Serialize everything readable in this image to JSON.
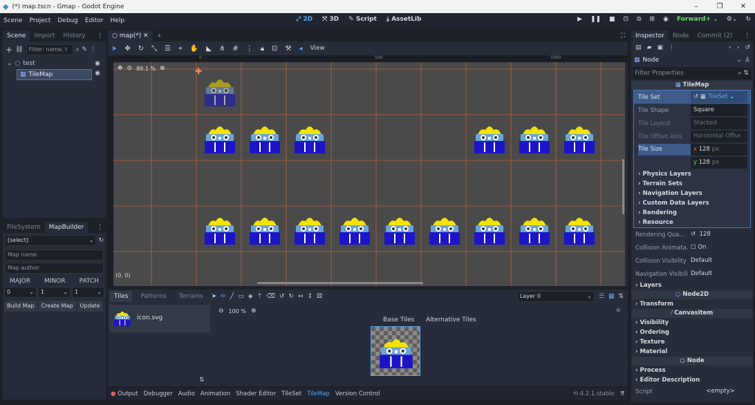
{
  "window": {
    "title": "(*) map.tscn - Gmap - Godot Engine",
    "controls": [
      "–",
      "❐",
      "✕"
    ]
  },
  "menu": [
    "Scene",
    "Project",
    "Debug",
    "Editor",
    "Help"
  ],
  "workspaces": [
    {
      "label": "2D",
      "active": true
    },
    {
      "label": "3D"
    },
    {
      "label": "Script"
    },
    {
      "label": "AssetLib"
    }
  ],
  "renderer": "Forward+",
  "scene_dock": {
    "tabs": [
      "Scene",
      "Import",
      "History"
    ],
    "filter_placeholder": "Filter: name, t",
    "tree": [
      {
        "label": "test",
        "level": 0
      },
      {
        "label": "TileMap",
        "level": 1,
        "selected": true
      }
    ]
  },
  "fs_dock": {
    "tabs": [
      "FileSystem",
      "MapBuilder"
    ],
    "select": "[select]",
    "map_name": "Map name",
    "map_author": "Map author",
    "version_headers": [
      "MAJOR",
      "MINOR",
      "PATCH"
    ],
    "version_values": [
      "0",
      "1",
      "1"
    ],
    "buttons": [
      "Build Map",
      "Create Map",
      "Update"
    ]
  },
  "viewport": {
    "tab": "map(*)",
    "zoom": "89.1 %",
    "view_label": "View",
    "origin_label": "(0, 0)",
    "ruler": [
      "0",
      "500",
      "1000"
    ]
  },
  "tilemap_panel": {
    "tabs": [
      "Tiles",
      "Patterns",
      "Terrains"
    ],
    "source": "icon.svg",
    "zoom": "100 %",
    "atlas_tabs": [
      "Base Tiles",
      "Alternative Tiles"
    ],
    "layer": "Layer 0"
  },
  "bottom_tabs": [
    "Output",
    "Debugger",
    "Audio",
    "Animation",
    "Shader Editor",
    "TileSet",
    "TileMap",
    "Version Control"
  ],
  "version": "4.2.1.stable",
  "inspector": {
    "tabs": [
      "Inspector",
      "Node",
      "Commit (2)"
    ],
    "node": "Node",
    "filter_placeholder": "Filter Properties",
    "class": "TileMap",
    "tile_set": {
      "label": "Tile Set",
      "value": "TileSet"
    },
    "props": [
      {
        "k": "Tile Shape",
        "v": "Square"
      },
      {
        "k": "Tile Layout",
        "v": "Stacked"
      },
      {
        "k": "Tile Offset Axis",
        "v": "Horizontal Offse"
      }
    ],
    "tile_size": {
      "label": "Tile Size",
      "x": "128",
      "y": "128",
      "unit": "px"
    },
    "tileset_sections": [
      "Physics Layers",
      "Terrain Sets",
      "Navigation Layers",
      "Custom Data Layers",
      "Rendering",
      "Resource"
    ],
    "rendering_quadrant": {
      "k": "Rendering Qua...",
      "v": "128"
    },
    "collision_anim": {
      "k": "Collision Animata...",
      "v": "On"
    },
    "collision_vis": {
      "k": "Collision Visibility ...",
      "v": "Default"
    },
    "nav_vis": {
      "k": "Navigation Visibili...",
      "v": "Default"
    },
    "layers": "Layers",
    "node2d": "Node2D",
    "transform": "Transform",
    "canvasitem": "CanvasItem",
    "ci_sections": [
      "Visibility",
      "Ordering",
      "Texture",
      "Material"
    ],
    "node_sections": [
      "Process",
      "Editor Description"
    ],
    "script": {
      "k": "Script",
      "v": "<empty>"
    }
  }
}
